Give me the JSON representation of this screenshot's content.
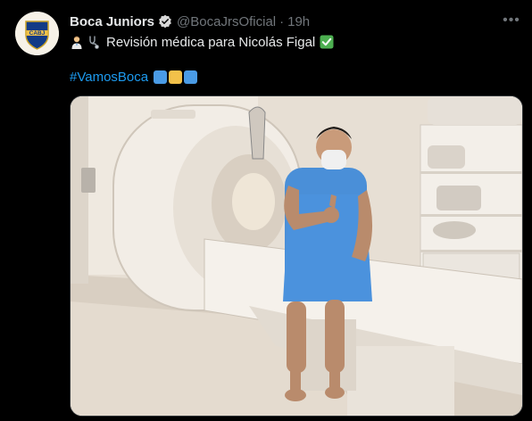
{
  "tweet": {
    "author_name": "Boca Juniors",
    "handle": "@BocaJrsOficial",
    "separator": "·",
    "time": "19h",
    "text": "Revisión médica para Nicolás Figal",
    "hashtag": "#VamosBoca",
    "more_label": "•••"
  },
  "avatar": {
    "monogram": "CABJ"
  },
  "icons": {
    "verified": "verified-badge-icon",
    "more": "more-options-icon",
    "emoji_doctor": "health-worker-emoji",
    "emoji_stethoscope": "stethoscope-emoji",
    "emoji_check": "check-mark-emoji",
    "flag": "boca-colors-squares"
  },
  "colors": {
    "link": "#1d9bf0",
    "secondary_text": "#71767b",
    "boca_blue": "#4a9be5",
    "boca_gold": "#f2c14a",
    "check_green": "#4caf50"
  }
}
